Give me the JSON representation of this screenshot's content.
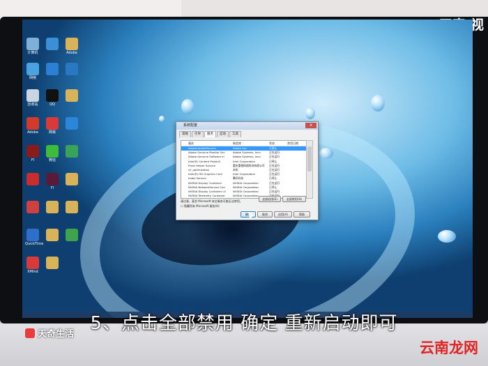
{
  "brand_top": "天奇·视",
  "subtitle": "5、点击全部禁用 确定 重新启动即可",
  "watermark_left": "天奇生活",
  "watermark_right": "云南龙网",
  "desktop_icons": [
    {
      "label": "计算机",
      "color": "#7fb0d8"
    },
    {
      "label": "",
      "color": "#3a8fd6"
    },
    {
      "label": "Adobe",
      "color": "#d9b35a"
    },
    {
      "label": "网络",
      "color": "#4aa3df"
    },
    {
      "label": "",
      "color": "#2d7fd3"
    },
    {
      "label": "",
      "color": "#2b78c2"
    },
    {
      "label": "回收站",
      "color": "#c9d6e2"
    },
    {
      "label": "QQ",
      "color": "#111111"
    },
    {
      "label": "",
      "color": "#d9b35a"
    },
    {
      "label": "Adobe",
      "color": "#d23b2b"
    },
    {
      "label": "网易",
      "color": "#d83a3a"
    },
    {
      "label": "",
      "color": "#2a86d9"
    },
    {
      "label": "Fl",
      "color": "#8a1b1b"
    },
    {
      "label": "微信",
      "color": "#3dbb3d"
    },
    {
      "label": "",
      "color": "#3aa35a"
    },
    {
      "label": "",
      "color": "#c92e2e"
    },
    {
      "label": "Fl",
      "color": "#5a1a3a"
    },
    {
      "label": "",
      "color": "#d9b35a"
    },
    {
      "label": "",
      "color": "#d04040"
    },
    {
      "label": "",
      "color": "#d9b35a"
    },
    {
      "label": "",
      "color": "#d9b35a"
    },
    {
      "label": "QuickTime",
      "color": "#2f6fc9"
    },
    {
      "label": "",
      "color": "#d9b35a"
    },
    {
      "label": "",
      "color": "#3fa34d"
    },
    {
      "label": "XMind",
      "color": "#d83a3a"
    },
    {
      "label": "",
      "color": "#d9b35a"
    }
  ],
  "dialog": {
    "title": "系统配置",
    "close": "x",
    "tabs": [
      "常规",
      "引导",
      "服务",
      "启动",
      "工具"
    ],
    "active_tab": 2,
    "headers": [
      "服务",
      "制造商",
      "状态",
      "禁用日期"
    ],
    "rows": [
      [
        "AdobeUpdateService",
        "Adobe Sys",
        "已停止",
        ""
      ],
      [
        "Adobe Genuine Monitor Ser",
        "Adobe Systems, Inco",
        "正在运行",
        ""
      ],
      [
        "Adobe Genuine Software In",
        "Adobe Systems, Inco",
        "正在运行",
        ""
      ],
      [
        "Intel(R) Content Protecti",
        "Intel Corporation",
        "已停止",
        ""
      ],
      [
        "Flash Helper Service",
        "重庆重橙网络科技有限公司",
        "正在运行",
        ""
      ],
      [
        "clr_optimization",
        "未知",
        "正在运行",
        ""
      ],
      [
        "Intel(R) HD Graphics Cont",
        "Intel Corporation",
        "正在运行",
        ""
      ],
      [
        "Index Service",
        "腾讯科技",
        "已停止",
        ""
      ],
      [
        "NVIDIA Display Container",
        "NVIDIA Corporation",
        "正在运行",
        ""
      ],
      [
        "NVIDIA NetworkService Con",
        "NVIDIA Corporation",
        "已停止",
        ""
      ],
      [
        "NVIDIA Display Container LS",
        "NVIDIA Corporation",
        "正在运行",
        ""
      ],
      [
        "NVIDIA Telemetry Container",
        "NVIDIA Corporation",
        "正在运行",
        ""
      ]
    ],
    "selected_row": 0,
    "note": "请注意，某些 Microsoft 安全服务可能无法禁用。",
    "enable_all": "全部启用(E)",
    "disable_all": "全部禁用(D)",
    "hide_ms": "隐藏所有 Microsoft 服务(H)",
    "ok": "确定",
    "cancel": "取消",
    "apply": "应用(A)",
    "help": "帮助"
  }
}
